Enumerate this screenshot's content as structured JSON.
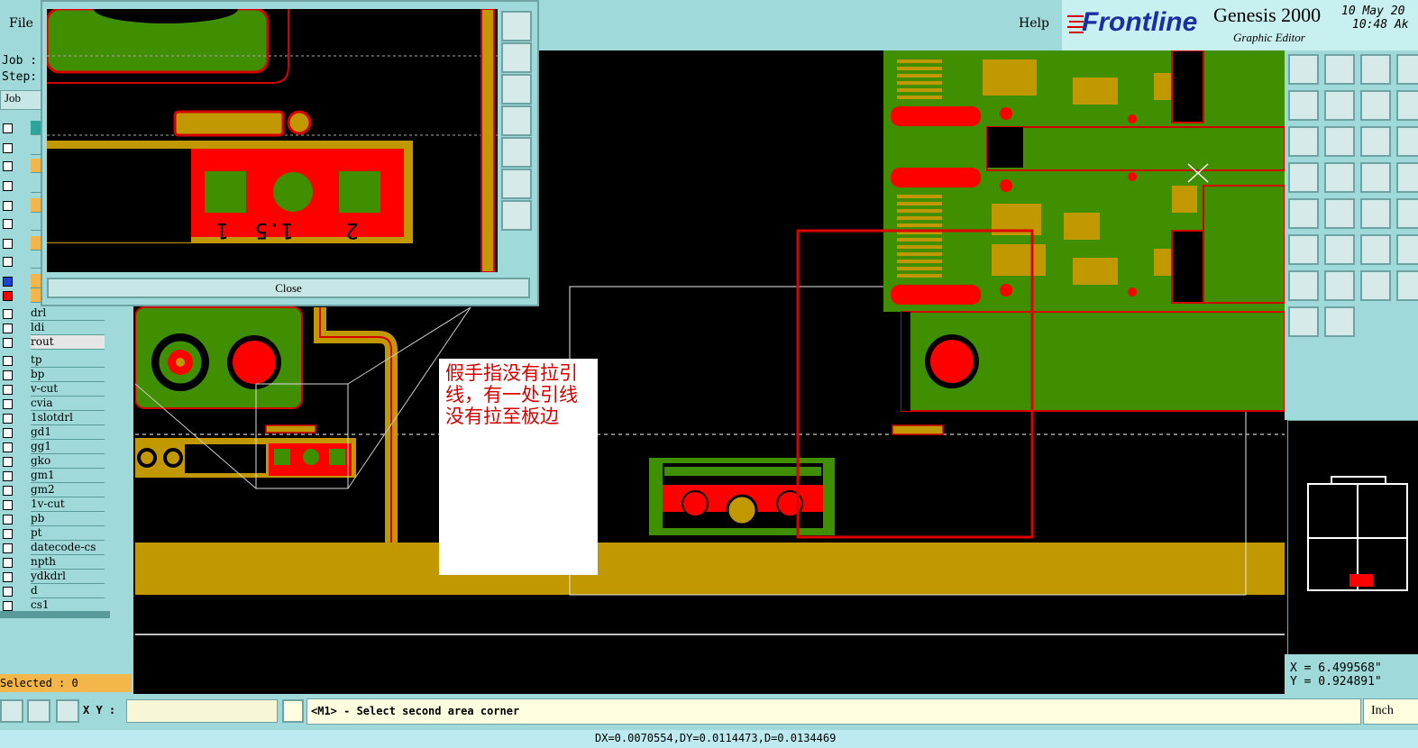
{
  "menu": {
    "file": "File",
    "help": "Help"
  },
  "brand": {
    "logo": "Frontline",
    "title": "Genesis 2000",
    "subtitle": "Graphic Editor",
    "date_line1": "10 May 20",
    "date_line2": "10:48 Ak"
  },
  "left_panel": {
    "job_label": "Job :",
    "step_label": "Step:",
    "job_button": "Job",
    "layers_upper": [
      "drl",
      "ldi",
      "rout"
    ],
    "layers": [
      "tp",
      "bp",
      "v-cut",
      "cvia",
      "1slotdrl",
      "gd1",
      "gg1",
      "gko",
      "gm1",
      "gm2",
      "1v-cut",
      "pb",
      "pt",
      "datecode-cs",
      "npth",
      "ydkdrl",
      "d",
      "cs1"
    ],
    "selected": "Selected : 0"
  },
  "popup": {
    "close_label": "Close",
    "pad_labels": [
      "1",
      "1.5",
      "2"
    ]
  },
  "annotation": {
    "text": "假手指没有拉引线，有一处引线没有拉至板边"
  },
  "coords": {
    "x": "X =  6.499568\"",
    "y": "Y =  0.924891\""
  },
  "bottom": {
    "xy_label": "X Y :",
    "message": "<M1> - Select second area corner",
    "unit": "Inch",
    "status": "DX=0.0070554,DY=0.0114473,D=0.0134469"
  },
  "toolbar_icons": [
    "zoom-home-icon",
    "zoom-in-icon",
    "home-icon",
    "zoom-prev-icon",
    "pan-left-icon",
    "pan-right-icon",
    "undo-icon",
    "scale-1-2-icon",
    "fit-icon",
    "center-icon",
    "grid-icon",
    "help-icon",
    "palette-icon",
    "snap-icon",
    "net-icon",
    "measure-icon",
    "feature-icon",
    "ruler-icon",
    "connect-icon",
    "cross-icon",
    "angle-icon",
    "route-icon",
    "arc-icon",
    "line-icon",
    "slice-icon",
    "pad-icon",
    "triangle-icon",
    "select-icon",
    "select-area-icon",
    "select-net-icon"
  ],
  "colors": {
    "cyan_ui": "#9fd9d9",
    "copper": "#c19800",
    "green": "#3f8f00",
    "red": "#ff0000",
    "selected_bar": "#f2b64a"
  }
}
